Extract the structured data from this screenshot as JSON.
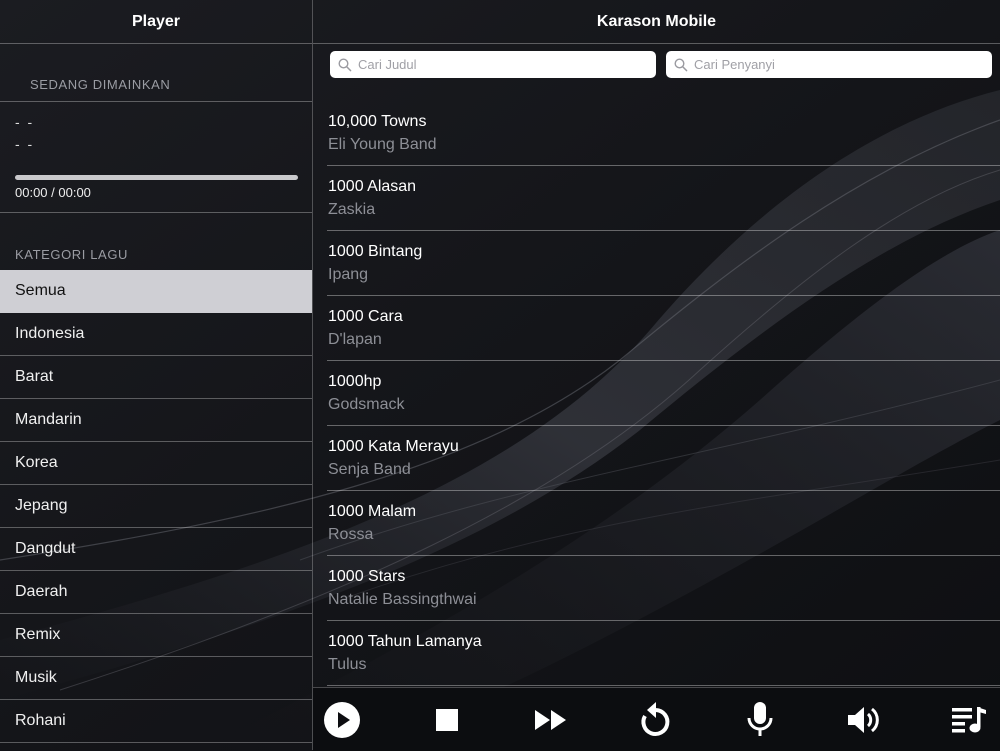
{
  "sidebar": {
    "title": "Player",
    "now_playing_heading": "SEDANG DIMAINKAN",
    "now_playing": {
      "title": "- -",
      "artist": "- -",
      "time": "00:00 / 00:00",
      "progress": 0
    },
    "category_heading": "KATEGORI LAGU",
    "categories": [
      {
        "label": "Semua",
        "selected": true
      },
      {
        "label": "Indonesia"
      },
      {
        "label": "Barat"
      },
      {
        "label": "Mandarin"
      },
      {
        "label": "Korea"
      },
      {
        "label": "Jepang"
      },
      {
        "label": "Dangdut"
      },
      {
        "label": "Daerah"
      },
      {
        "label": "Remix"
      },
      {
        "label": "Musik"
      },
      {
        "label": "Rohani"
      }
    ]
  },
  "main": {
    "title": "Karason Mobile",
    "search_title_placeholder": "Cari Judul",
    "search_artist_placeholder": "Cari Penyanyi",
    "songs": [
      {
        "title": "10,000 Towns",
        "artist": "Eli Young Band"
      },
      {
        "title": "1000 Alasan",
        "artist": "Zaskia"
      },
      {
        "title": "1000 Bintang",
        "artist": "Ipang"
      },
      {
        "title": "1000 Cara",
        "artist": "D'lapan"
      },
      {
        "title": "1000hp",
        "artist": "Godsmack"
      },
      {
        "title": "1000 Kata Merayu",
        "artist": "Senja Band"
      },
      {
        "title": "1000 Malam",
        "artist": "Rossa"
      },
      {
        "title": "1000 Stars",
        "artist": "Natalie Bassingthwai"
      },
      {
        "title": "1000 Tahun Lamanya",
        "artist": "Tulus"
      }
    ]
  },
  "controls": {
    "icons": [
      "play-icon",
      "stop-icon",
      "fast-forward-icon",
      "replay-icon",
      "microphone-icon",
      "volume-icon",
      "playlist-icon"
    ]
  },
  "colors": {
    "selected_category_bg": "#cfcfd4",
    "artist_text": "#8d8f96",
    "background": "#121317"
  }
}
